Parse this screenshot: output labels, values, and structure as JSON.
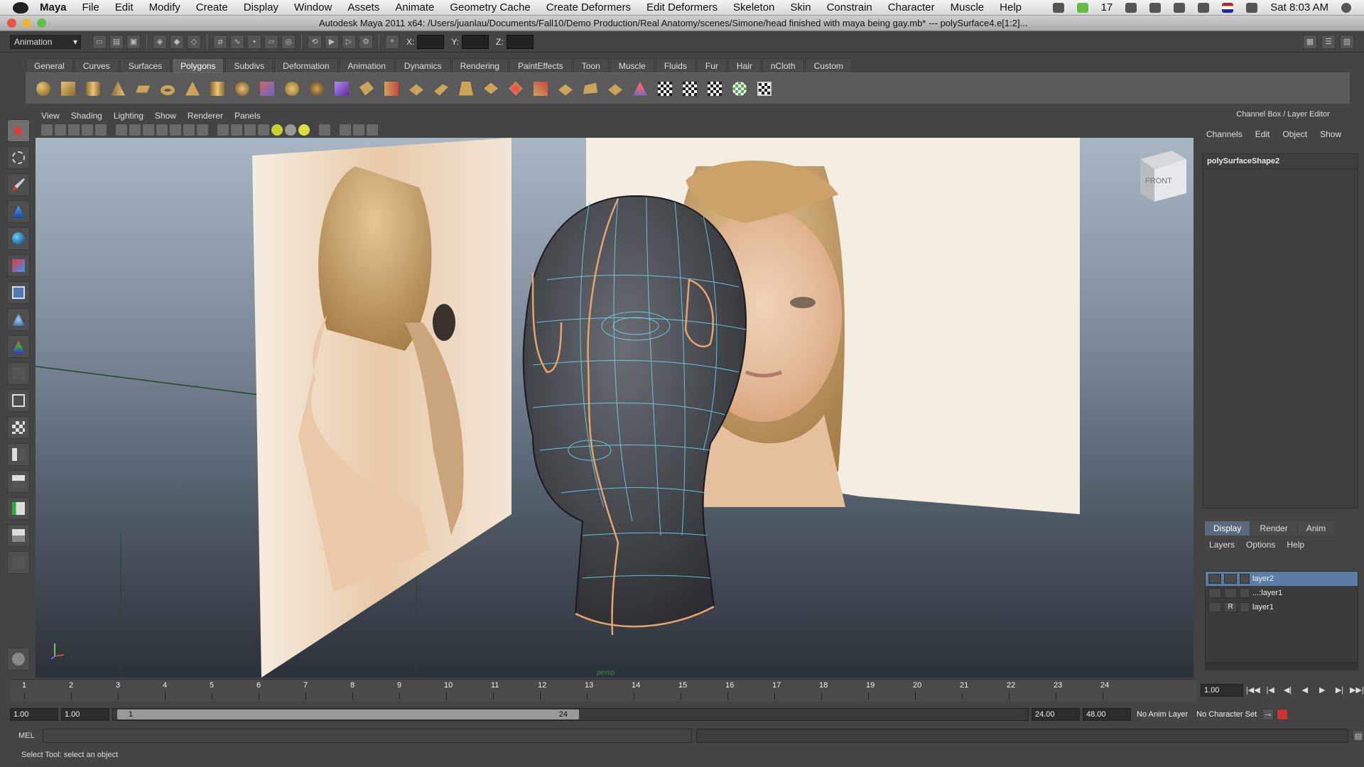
{
  "menubar": {
    "app": "Maya",
    "items": [
      "File",
      "Edit",
      "Modify",
      "Create",
      "Display",
      "Window",
      "Assets",
      "Animate",
      "Geometry Cache",
      "Create Deformers",
      "Edit Deformers",
      "Skeleton",
      "Skin",
      "Constrain",
      "Character",
      "Muscle",
      "Help"
    ],
    "tray_count": "17",
    "clock": "Sat 8:03 AM"
  },
  "window": {
    "title": "Autodesk Maya 2011 x64: /Users/juanlau/Documents/Fall10/Demo Production/Real Anatomy/scenes/Simone/head finished with maya being gay.mb*   ---   polySurface4.e[1:2]..."
  },
  "statusline": {
    "menuset": "Animation",
    "x_label": "X:",
    "y_label": "Y:",
    "z_label": "Z:"
  },
  "shelf": {
    "tabs": [
      "General",
      "Curves",
      "Surfaces",
      "Polygons",
      "Subdivs",
      "Deformation",
      "Animation",
      "Dynamics",
      "Rendering",
      "PaintEffects",
      "Toon",
      "Muscle",
      "Fluids",
      "Fur",
      "Hair",
      "nCloth",
      "Custom"
    ],
    "active_tab": "Polygons"
  },
  "panel": {
    "menu": [
      "View",
      "Shading",
      "Lighting",
      "Show",
      "Renderer",
      "Panels"
    ],
    "view_cube_label": "FRONT",
    "camera_label": "persp"
  },
  "channelbox": {
    "title": "Channel Box / Layer Editor",
    "menu": [
      "Channels",
      "Edit",
      "Object",
      "Show"
    ],
    "object": "polySurfaceShape2"
  },
  "layereditor": {
    "tabs": [
      "Display",
      "Render",
      "Anim"
    ],
    "menu": [
      "Layers",
      "Options",
      "Help"
    ],
    "layers": [
      {
        "name": "layer2",
        "flag": "",
        "selected": true
      },
      {
        "name": "...:layer1",
        "flag": "",
        "selected": false
      },
      {
        "name": "layer1",
        "flag": "R",
        "selected": false
      }
    ]
  },
  "timeline": {
    "ticks": [
      "1",
      "2",
      "3",
      "4",
      "5",
      "6",
      "7",
      "8",
      "9",
      "10",
      "11",
      "12",
      "13",
      "14",
      "15",
      "16",
      "17",
      "18",
      "19",
      "20",
      "21",
      "22",
      "23",
      "24"
    ],
    "current_time": "1.00"
  },
  "range": {
    "start_time": "1.00",
    "playback_start": "1.00",
    "range_start": "1",
    "range_end": "24",
    "playback_end": "24.00",
    "end_time": "48.00",
    "anim_layer": "No Anim Layer",
    "character_set": "No Character Set"
  },
  "command": {
    "label": "MEL",
    "help": "Select Tool: select an object"
  },
  "colors": {
    "wire": "#6fd6ef",
    "selected_edge": "#e8a46a",
    "layer_selected": "#5c7ea6"
  }
}
